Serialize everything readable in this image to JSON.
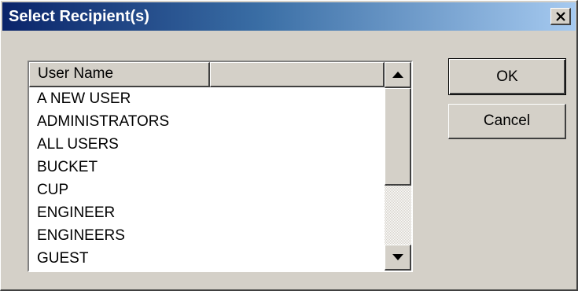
{
  "window": {
    "title": "Select Recipient(s)",
    "close_glyph": "✕"
  },
  "listview": {
    "columns": [
      "User Name",
      ""
    ],
    "rows": [
      "A NEW USER",
      "ADMINISTRATORS",
      "ALL USERS",
      "BUCKET",
      "CUP",
      "ENGINEER",
      "ENGINEERS",
      "GUEST"
    ],
    "scrollbar": {
      "up_icon": "scroll-up-arrow-icon",
      "down_icon": "scroll-down-arrow-icon"
    }
  },
  "buttons": {
    "ok_label": "OK",
    "cancel_label": "Cancel"
  },
  "colors": {
    "title_start": "#0a246a",
    "title_end": "#a6caf0",
    "face": "#d4d0c8"
  }
}
